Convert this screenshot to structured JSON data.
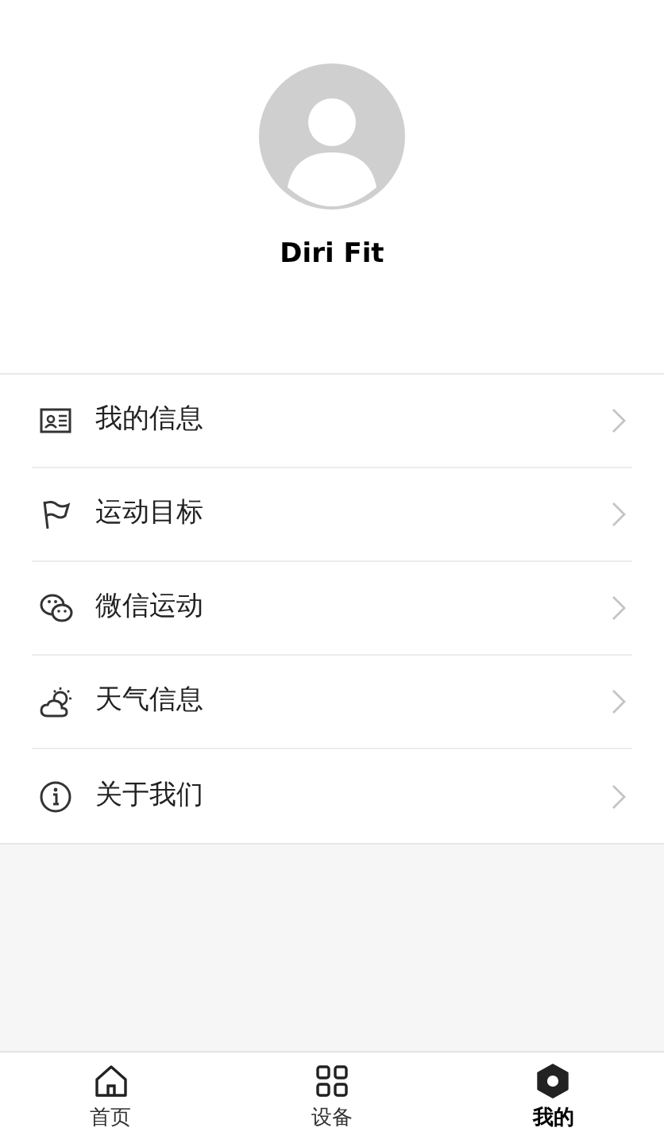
{
  "profile": {
    "name": "Diri Fit"
  },
  "menu": [
    {
      "kind": "card",
      "label": "我的信息"
    },
    {
      "kind": "flag",
      "label": "运动目标"
    },
    {
      "kind": "chat",
      "label": "微信运动"
    },
    {
      "kind": "weather",
      "label": "天气信息"
    },
    {
      "kind": "info",
      "label": "关于我们"
    }
  ],
  "tabs": [
    {
      "kind": "home",
      "label": "首页",
      "selected": false
    },
    {
      "kind": "devices",
      "label": "设备",
      "selected": false
    },
    {
      "kind": "me",
      "label": "我的",
      "selected": true
    }
  ]
}
